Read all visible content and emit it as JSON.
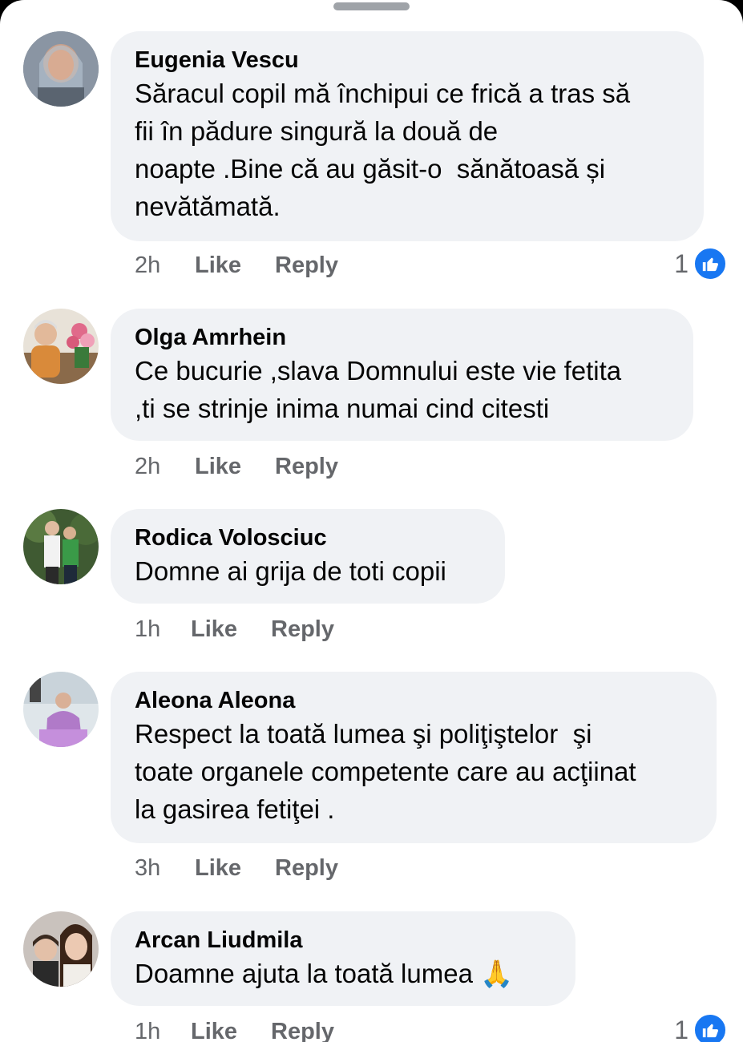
{
  "actions": {
    "like_label": "Like",
    "reply_label": "Reply"
  },
  "colors": {
    "bubble": "#f0f2f5",
    "meta_text": "#65676b",
    "accent": "#1877f2",
    "text": "#050505"
  },
  "comments": [
    {
      "author": "Eugenia Vescu",
      "text": "Săracul copil mă închipui ce frică a tras să\nfii în pădure singură la două de\nnoapte .Bine că au găsit-o  sănătoasă și\nnevătămată.",
      "time": "2h",
      "reaction_count": "1",
      "reaction_icon": "thumbs-up-icon"
    },
    {
      "author": "Olga Amrhein",
      "text": "Ce bucurie ,slava Domnului este vie fetita\n,ti se strinje inima numai cind citesti",
      "time": "2h"
    },
    {
      "author": "Rodica Volosciuc",
      "text": "Domne ai grija de toti copii",
      "time": "1h"
    },
    {
      "author": "Aleona Aleona",
      "text": "Respect la toată lumea şi poliţiştelor  şi\ntoate organele competente care au acţiinat\nla gasirea fetiţei .",
      "time": "3h"
    },
    {
      "author": "Arcan Liudmila",
      "text": "Doamne ajuta la toată lumea ",
      "emoji": "🙏",
      "time": "1h",
      "reaction_count": "1",
      "reaction_icon": "thumbs-up-icon"
    }
  ]
}
